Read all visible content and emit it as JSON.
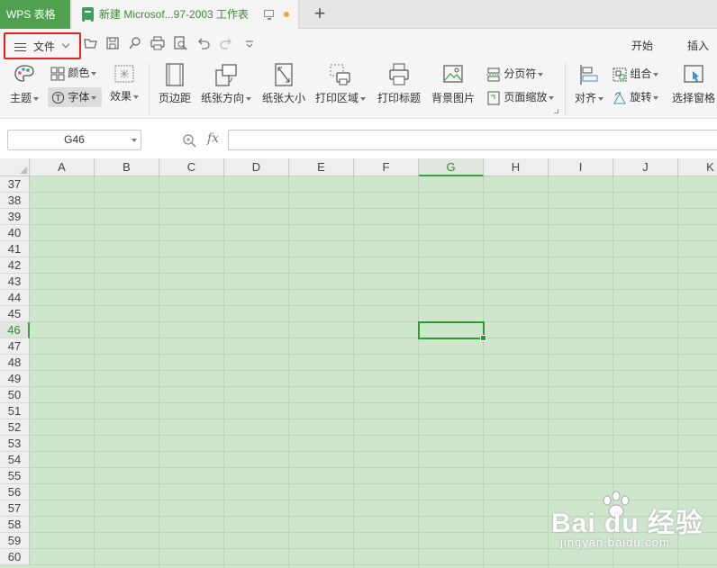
{
  "titlebar": {
    "app_tab": "WPS 表格",
    "doc_tab_title": "新建 Microsof...97-2003 工作表",
    "new_tab": "+"
  },
  "quickbar": {
    "file_menu_label": "文件",
    "menu_start": "开始",
    "menu_insert": "插入"
  },
  "ribbon": {
    "theme": "主题",
    "color": "颜色",
    "font": "字体",
    "effect": "效果",
    "margins": "页边距",
    "orientation": "纸张方向",
    "paper_size": "纸张大小",
    "print_area": "打印区域",
    "print_titles": "打印标题",
    "background": "背景图片",
    "page_break": "分页符",
    "page_scale": "页面缩放",
    "align": "对齐",
    "group": "组合",
    "rotate": "旋转",
    "selection_pane": "选择窗格"
  },
  "formulabar": {
    "cell_ref": "G46",
    "fx": "fx",
    "formula_value": ""
  },
  "sheet": {
    "columns": [
      "A",
      "B",
      "C",
      "D",
      "E",
      "F",
      "G",
      "H",
      "I",
      "J",
      "K"
    ],
    "rows": [
      "37",
      "38",
      "39",
      "40",
      "41",
      "42",
      "43",
      "44",
      "45",
      "46",
      "47",
      "48",
      "49",
      "50",
      "51",
      "52",
      "53",
      "54",
      "55",
      "56",
      "57",
      "58",
      "59",
      "60"
    ],
    "active_column": "G",
    "active_row": "46"
  },
  "watermark": {
    "brand": "Bai du 经验",
    "site": "jingyan.baidu.com"
  },
  "colors": {
    "accent_green": "#4fa14f",
    "sheet_background": "#cde6cc",
    "file_highlight": "#e8201e"
  }
}
